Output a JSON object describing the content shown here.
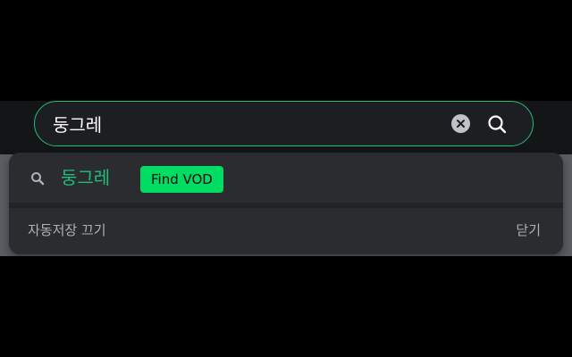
{
  "search": {
    "value": "둥그레",
    "clear_icon": "clear-x-circle-icon",
    "search_icon": "magnifier-icon"
  },
  "dropdown": {
    "suggestions": [
      {
        "icon": "magnifier-icon",
        "text": "둥그레",
        "badge": "Find VOD"
      }
    ],
    "autosave_label": "자동저장 끄기",
    "close_label": "닫기"
  },
  "colors": {
    "accent_green": "#1fbf78",
    "badge_green": "#00dc64",
    "dropdown_bg": "#2b2c30",
    "bar_bg": "#1d1e21"
  }
}
